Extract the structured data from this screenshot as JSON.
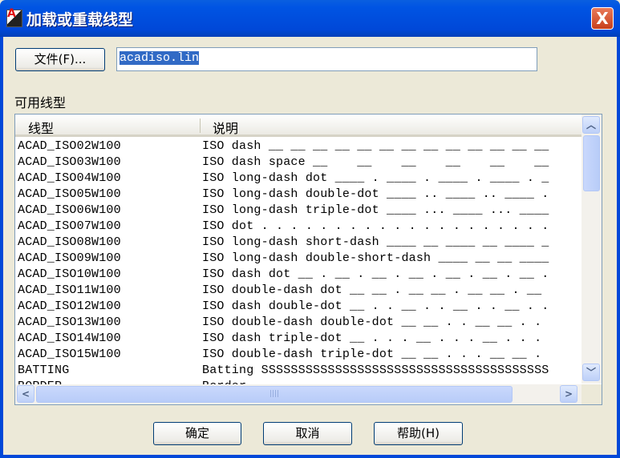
{
  "window": {
    "title": "加载或重载线型",
    "close": "X"
  },
  "file_button": "文件(F)...",
  "file_input": "acadiso.lin",
  "available_label": "可用线型",
  "columns": [
    "线型",
    "说明"
  ],
  "rows": [
    [
      "ACAD_ISO02W100",
      "ISO dash __ __ __ __ __ __ __ __ __ __ __ __ __ __"
    ],
    [
      "ACAD_ISO03W100",
      "ISO dash space __    __    __    __    __    __"
    ],
    [
      "ACAD_ISO04W100",
      "ISO long-dash dot ____ . ____ . ____ . ____ . _"
    ],
    [
      "ACAD_ISO05W100",
      "ISO long-dash double-dot ____ .. ____ .. ____ ."
    ],
    [
      "ACAD_ISO06W100",
      "ISO long-dash triple-dot ____ ... ____ ... ____"
    ],
    [
      "ACAD_ISO07W100",
      "ISO dot . . . . . . . . . . . . . . . . . . . ."
    ],
    [
      "ACAD_ISO08W100",
      "ISO long-dash short-dash ____ __ ____ __ ____ _"
    ],
    [
      "ACAD_ISO09W100",
      "ISO long-dash double-short-dash ____ __ __ ____"
    ],
    [
      "ACAD_ISO10W100",
      "ISO dash dot __ . __ . __ . __ . __ . __ . __ ."
    ],
    [
      "ACAD_ISO11W100",
      "ISO double-dash dot __ __ . __ __ . __ __ . __"
    ],
    [
      "ACAD_ISO12W100",
      "ISO dash double-dot __ . . __ . . __ . . __ . ."
    ],
    [
      "ACAD_ISO13W100",
      "ISO double-dash double-dot __ __ . . __ __ . ."
    ],
    [
      "ACAD_ISO14W100",
      "ISO dash triple-dot __ . . . __ . . . __ . . ."
    ],
    [
      "ACAD_ISO15W100",
      "ISO double-dash triple-dot __ __ . . . __ __ ."
    ],
    [
      "BATTING",
      "Batting SSSSSSSSSSSSSSSSSSSSSSSSSSSSSSSSSSSSSSS"
    ],
    [
      "BORDER",
      "Border"
    ]
  ],
  "buttons": {
    "ok": "确定",
    "cancel": "取消",
    "help": "帮助(H)"
  }
}
